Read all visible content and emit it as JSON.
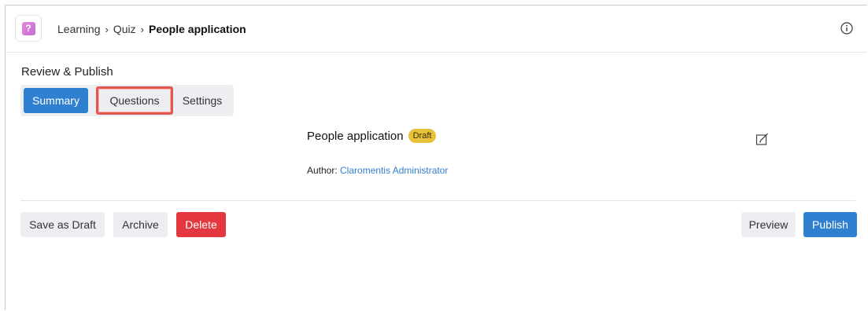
{
  "breadcrumb": {
    "items": [
      "Learning",
      "Quiz"
    ],
    "separator": "›",
    "current": "People application"
  },
  "app_icon": {
    "glyph": "?",
    "name": "quiz-icon"
  },
  "section": {
    "title": "Review & Publish"
  },
  "tabs": [
    {
      "label": "Summary",
      "active": true
    },
    {
      "label": "Questions",
      "highlighted": true
    },
    {
      "label": "Settings"
    }
  ],
  "quiz": {
    "title": "People application",
    "status_badge": "Draft",
    "author_label": "Author:",
    "author_name": "Claromentis Administrator"
  },
  "actions": {
    "save_draft": "Save as Draft",
    "archive": "Archive",
    "delete": "Delete",
    "preview": "Preview",
    "publish": "Publish"
  },
  "colors": {
    "primary": "#2f80d1",
    "danger": "#e5373f",
    "badge": "#e7c13a",
    "highlight_border": "#e0574f"
  }
}
